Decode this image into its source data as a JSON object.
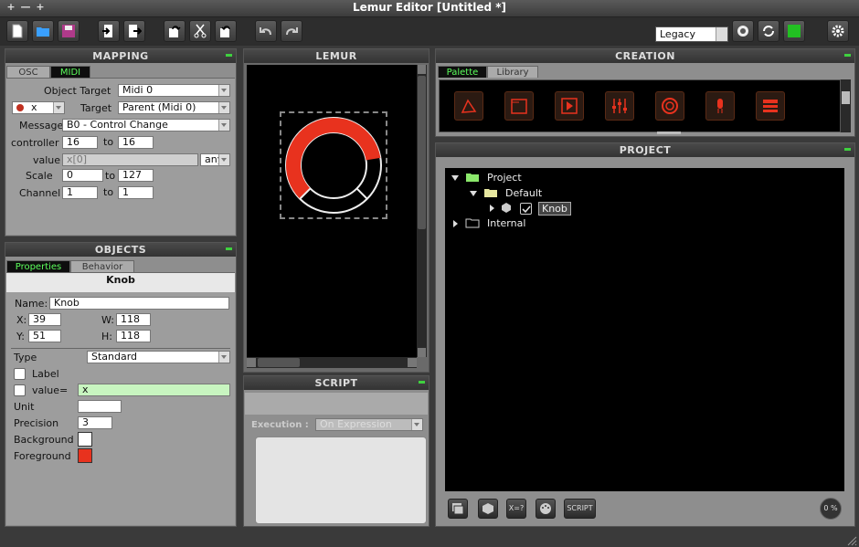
{
  "window": {
    "title": "Lemur Editor [Untitled *]",
    "controls": [
      "+",
      "—",
      "+"
    ]
  },
  "toolbar": {
    "buttons": [
      "new-file",
      "open-folder",
      "save",
      "import",
      "export",
      "undo-arrow",
      "cut",
      "redo-arrow",
      "undo",
      "redo"
    ],
    "mode_select": "Legacy",
    "right_buttons": [
      "lemur-device",
      "sync",
      "connection-status",
      "settings"
    ]
  },
  "mapping": {
    "title": "MAPPING",
    "tabs": [
      "OSC",
      "MIDI"
    ],
    "object_target_label": "Object Target",
    "object_target_value": "Midi 0",
    "var_value": "x",
    "target_label": "Target",
    "target_value": "Parent (Midi 0)",
    "message_label": "Message",
    "message_value": "B0 - Control Change",
    "controller_label": "controller",
    "controller_from": "16",
    "to_label": "to",
    "controller_to": "16",
    "value_label": "value",
    "value_expr": "x[0]",
    "value_any": "any",
    "scale_label": "Scale",
    "scale_from": "0",
    "scale_to": "127",
    "channel_label": "Channel",
    "channel_from": "1",
    "channel_to": "1"
  },
  "objects": {
    "title": "OBJECTS",
    "tabs": [
      "Properties",
      "Behavior"
    ],
    "object_name": "Knob",
    "name_label": "Name:",
    "name_value": "Knob",
    "x_label": "X:",
    "x_value": "39",
    "y_label": "Y:",
    "y_value": "51",
    "w_label": "W:",
    "w_value": "118",
    "h_label": "H:",
    "h_value": "118",
    "type_label": "Type",
    "type_value": "Standard",
    "label_label": "Label",
    "value_eq_label": "value=",
    "value_eq_value": "x",
    "unit_label": "Unit",
    "unit_value": "",
    "precision_label": "Precision",
    "precision_value": "3",
    "background_label": "Background",
    "background_color": "#ffffff",
    "foreground_label": "Foreground",
    "foreground_color": "#e8321e"
  },
  "lemur": {
    "title": "LEMUR",
    "knob_fraction": 0.8,
    "knob_color": "#e8321e"
  },
  "script": {
    "title": "SCRIPT",
    "execution_label": "Execution :",
    "execution_value": "On Expression"
  },
  "creation": {
    "title": "CREATION",
    "tabs": [
      "Palette",
      "Library"
    ],
    "palette_items": [
      "multiball-icon",
      "container-icon",
      "pads-icon",
      "faders-icon",
      "knob-icon",
      "led-icon",
      "menu-icon"
    ]
  },
  "project": {
    "title": "PROJECT",
    "tree": {
      "root": "Project",
      "interface": "Default",
      "object": "Knob",
      "internal": "Internal"
    },
    "bottom_buttons": [
      "interface-btn",
      "object-btn",
      "expression-btn",
      "midi-btn",
      "SCRIPT"
    ],
    "script_button": "SCRIPT",
    "expr_button": "X=?",
    "memory": "0 %"
  },
  "colors": {
    "accent_green": "#3fd13f",
    "knob_red": "#e8321e"
  }
}
